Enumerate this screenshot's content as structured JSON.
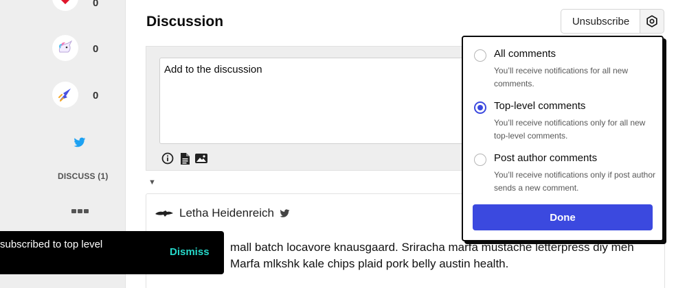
{
  "sidebar": {
    "reactions": [
      {
        "name": "heart",
        "count": "0"
      },
      {
        "name": "unicorn",
        "count": "0"
      },
      {
        "name": "reading-list",
        "count": "0"
      }
    ],
    "discuss_label": "DISCUSS (1)"
  },
  "main": {
    "title": "Discussion",
    "unsubscribe_label": "Unsubscribe",
    "comment_placeholder": "Add to the discussion",
    "comment": {
      "author": "Letha Heidenreich",
      "text_line1": "mall batch locavore knausgaard. Sriracha marfa mustache letterpress diy meh",
      "text_line2": "Marfa mlkshk kale chips plaid pork belly austin health."
    }
  },
  "dropdown": {
    "options": [
      {
        "title": "All comments",
        "desc": "You’ll receive notifications for all new comments.",
        "checked": false
      },
      {
        "title": "Top-level comments",
        "desc": "You’ll receive notifications only for all new top-level comments.",
        "checked": true
      },
      {
        "title": "Post author comments",
        "desc": "You’ll receive notifications only if post author sends a new comment.",
        "checked": false
      }
    ],
    "done_label": "Done"
  },
  "toast": {
    "message": "subscribed to top level",
    "dismiss_label": "Dismiss"
  },
  "colors": {
    "accent": "#3b49df",
    "toast_action": "#26d9ca",
    "heart": "#e0162b",
    "twitter": "#1da1f2"
  },
  "icons": [
    "heart-icon",
    "unicorn-icon",
    "reading-list-icon",
    "twitter-icon",
    "more-icon",
    "settings-icon",
    "info-icon",
    "document-icon",
    "image-icon",
    "collapse-icon",
    "author-avatar-icon"
  ]
}
